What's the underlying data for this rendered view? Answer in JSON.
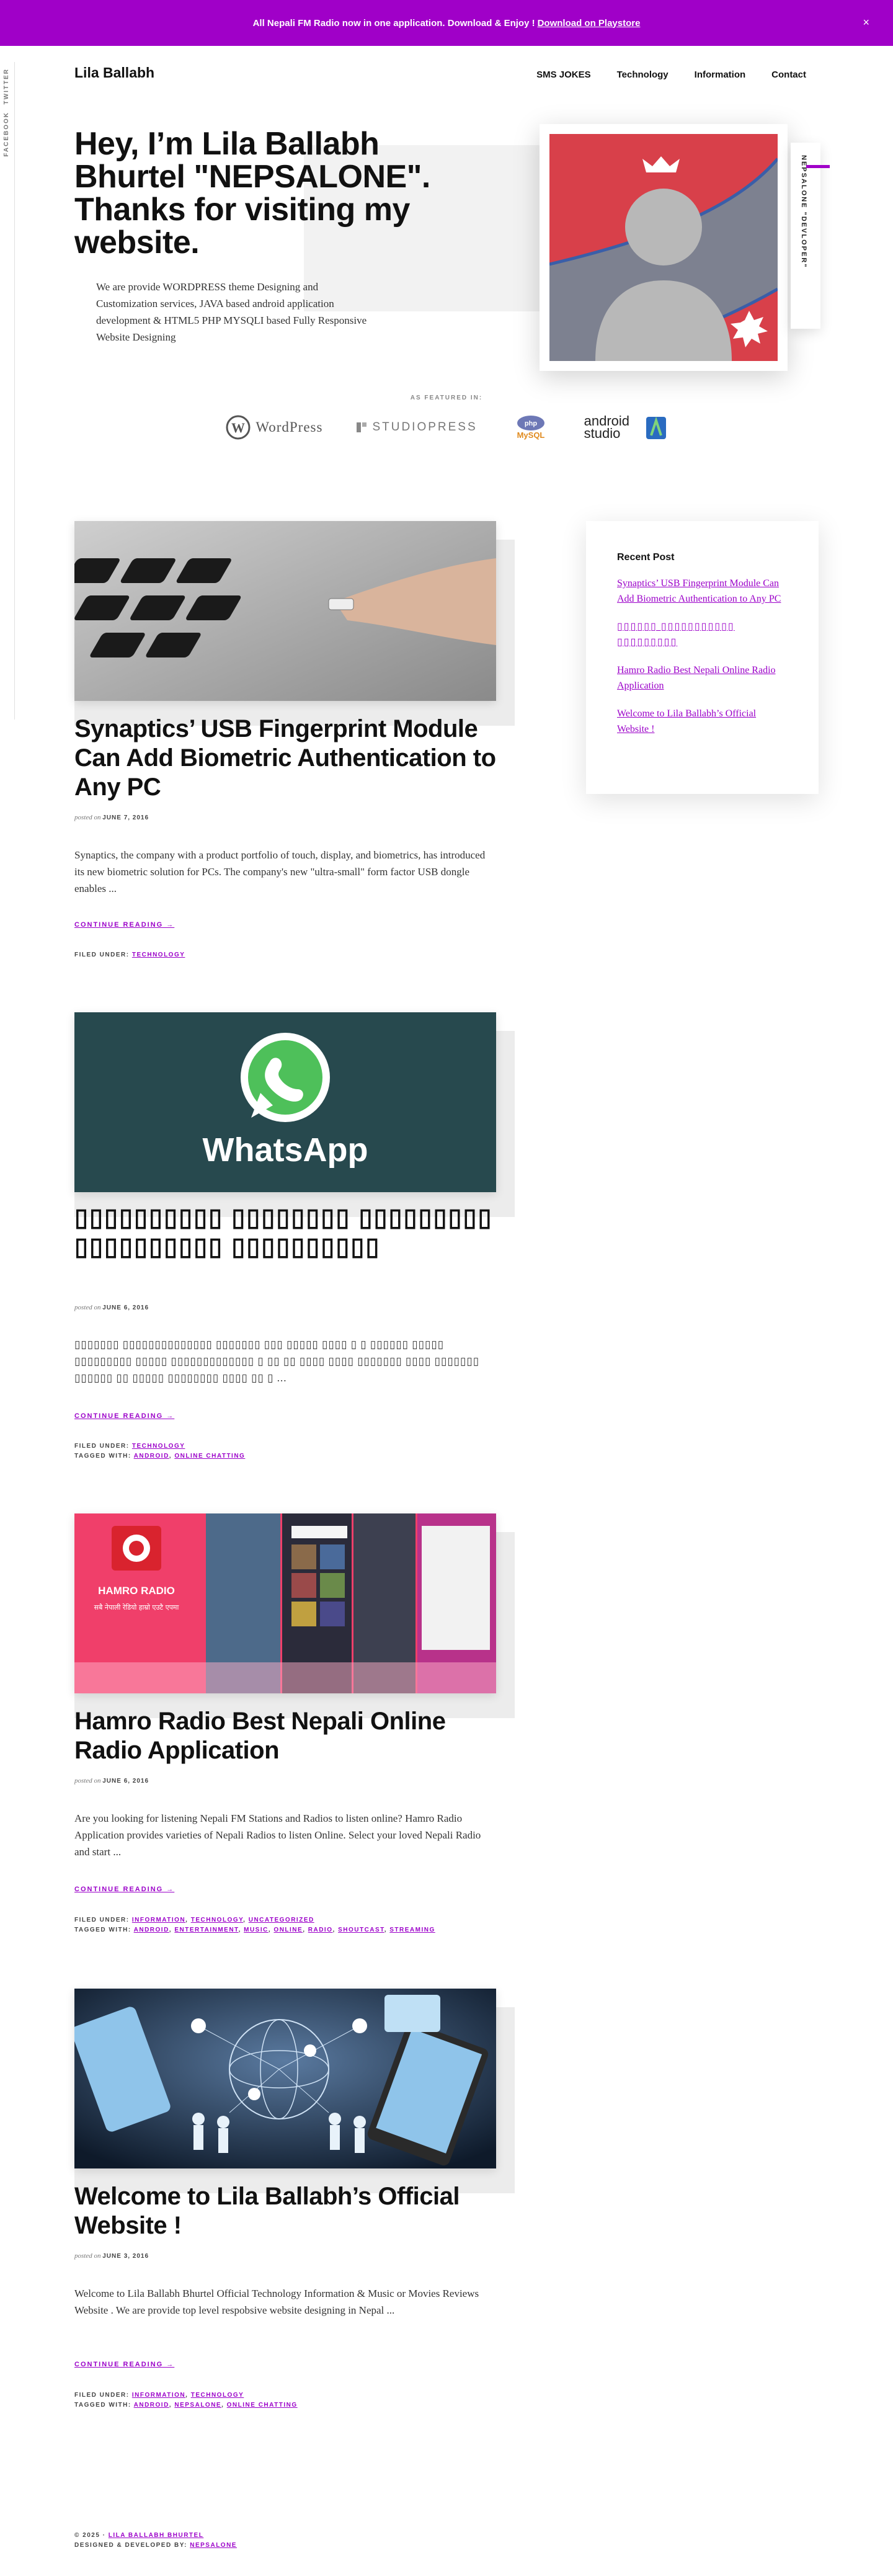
{
  "banner": {
    "text": "All Nepali FM Radio now in one application. Download & Enjoy !",
    "link": "Download on Playstore",
    "close_label": "×"
  },
  "social_rail": {
    "twitter": "TWITTER",
    "facebook": "FACEBOOK"
  },
  "header": {
    "site_title": "Lila Ballabh",
    "nav": [
      "SMS JOKES",
      "Technology",
      "Information",
      "Contact"
    ]
  },
  "hero": {
    "heading": "Hey, I’m Lila Ballabh Bhurtel \"NEPSALONE\". Thanks for visiting my website.",
    "description": "We are provide WORDPRESS theme Designing and Customization services, JAVA based android application development & HTML5 PHP MYSQLI based Fully Responsive Website Designing",
    "vertical_label": "NEPSALONE \"DEVLOPER\"",
    "featured_label": "AS FEATURED IN:",
    "logos": [
      "WordPress",
      "STUDIOPRESS",
      "MySQL",
      "android studio"
    ],
    "colors": {
      "accent": "#a000c8",
      "photo_red": "#d8404a",
      "photo_grey": "#7d8190"
    }
  },
  "posts": [
    {
      "title": "Synaptics’ USB Fingerprint Module Can Add Biometric Authentication to Any PC",
      "posted_on": "posted on",
      "date": "JUNE 7, 2016",
      "excerpt": "Synaptics, the company with a product portfolio of touch, display, and biometrics, has introduced its new biometric solution for PCs. The company's new \"ultra-small\" form factor USB dongle enables ...",
      "continue": "CONTINUE READING →",
      "filed_label": "FILED UNDER:",
      "filed": [
        "TECHNOLOGY"
      ],
      "tagged_label": "",
      "tags": []
    },
    {
      "title": "▯▯▯▯▯▯▯▯▯▯ ▯▯▯▯▯▯▯▯ ▯▯▯▯▯▯▯▯▯ ▯▯▯▯▯▯▯▯▯▯ ▯▯▯▯▯▯▯▯▯▯",
      "posted_on": "posted on",
      "date": "JUNE 6, 2016",
      "excerpt": "▯▯▯▯▯▯▯ ▯▯▯▯▯▯▯▯▯▯▯▯▯▯ ▯▯▯▯▯▯▯ ▯▯▯ ▯▯▯▯▯ ▯▯▯▯ ▯ ▯ ▯▯▯▯▯▯ ▯▯▯▯▯ ▯▯▯▯▯▯▯▯▯ ▯▯▯▯▯ ▯▯▯▯▯▯▯▯▯▯▯▯▯ ▯ ▯▯ ▯▯ ▯▯▯▯ ▯▯▯▯ ▯▯▯▯▯▯▯ ▯▯▯▯ ▯▯▯▯▯▯▯ ▯▯▯▯▯▯ ▯▯ ▯▯▯▯▯ ▯▯▯▯▯▯▯▯ ▯▯▯▯ ▯▯ ▯ ...",
      "continue": "CONTINUE READING →",
      "filed_label": "FILED UNDER:",
      "filed": [
        "TECHNOLOGY"
      ],
      "tagged_label": "TAGGED WITH:",
      "tags": [
        "ANDROID",
        "ONLINE CHATTING"
      ]
    },
    {
      "title": "Hamro Radio Best Nepali Online Radio Application",
      "posted_on": "posted on",
      "date": "JUNE 6, 2016",
      "excerpt": "Are you looking for listening Nepali FM Stations and Radios to listen online? Hamro Radio Application provides varieties of Nepali Radios to listen Online. Select your loved Nepali Radio and start ...",
      "continue": "CONTINUE READING →",
      "filed_label": "FILED UNDER:",
      "filed": [
        "INFORMATION",
        "TECHNOLOGY",
        "UNCATEGORIZED"
      ],
      "tagged_label": "TAGGED WITH:",
      "tags": [
        "ANDROID",
        "ENTERTAINMENT",
        "MUSIC",
        "ONLINE",
        "RADIO",
        "SHOUTCAST",
        "STREAMING"
      ]
    },
    {
      "title": "Welcome to Lila Ballabh’s Official Website !",
      "posted_on": "posted on",
      "date": "JUNE 3, 2016",
      "excerpt": "Welcome to Lila Ballabh Bhurtel Official Technology Information & Music or Movies Reviews Website . We are provide top level respobsive website designing in Nepal ...",
      "continue": "CONTINUE READING →",
      "filed_label": "FILED UNDER:",
      "filed": [
        "INFORMATION",
        "TECHNOLOGY"
      ],
      "tagged_label": "TAGGED WITH:",
      "tags": [
        "ANDROID",
        "NEPSALONE",
        "ONLINE CHATTING"
      ]
    }
  ],
  "post_images": {
    "hamro_radio_title": "HAMRO RADIO",
    "hamro_radio_sub": "सबै नेपाली रेडियो हाम्रो एउटै एपमा",
    "whatsapp_label": "WhatsApp"
  },
  "sidebar": {
    "title": "Recent Post",
    "links": [
      "Synaptics’ USB Fingerprint Module Can Add Biometric Authentication to Any PC",
      "▯▯▯▯▯▯ ▯▯▯▯▯▯▯▯▯▯▯ ▯▯▯▯▯▯▯▯▯",
      "Hamro Radio Best Nepali Online Radio Application",
      "Welcome to Lila Ballabh’s Official Website !"
    ]
  },
  "footer": {
    "copyright": "© 2025 ·",
    "copyright_link": "LILA BALLABH BHURTEL",
    "designed_by": "DESIGNED & DEVELOPED BY:",
    "designed_link": "NEPSALONE"
  }
}
